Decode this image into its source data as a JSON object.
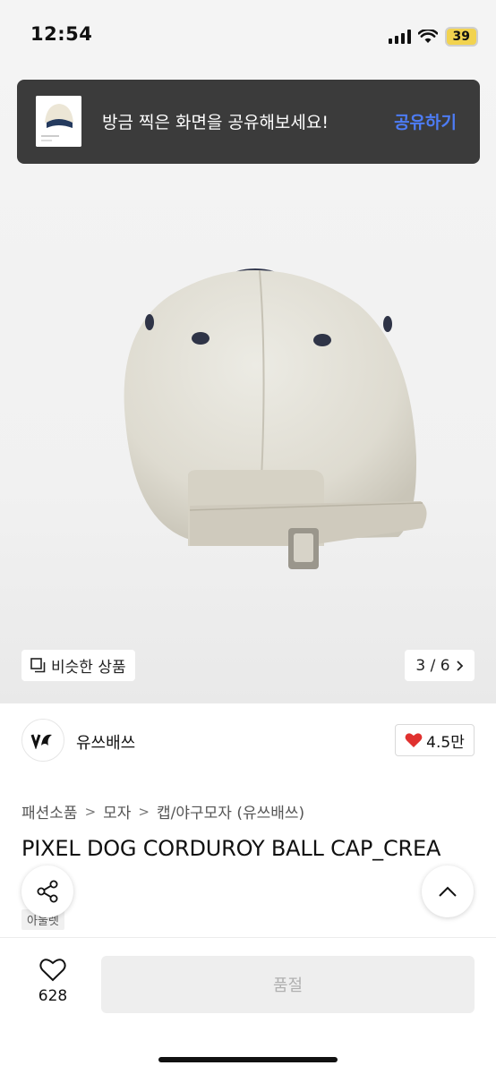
{
  "status_bar": {
    "time": "12:54",
    "battery": "39"
  },
  "share_banner": {
    "text": "방금 찍은 화면을 공유해보세요!",
    "action": "공유하기"
  },
  "image_nav": {
    "similar_label": "비슷한 상품",
    "pager": "3 / 6"
  },
  "seller": {
    "name": "유쓰배쓰",
    "likes": "4.5만"
  },
  "breadcrumb": [
    "패션소품",
    "모자",
    "캡/야구모자 (유쓰배쓰)"
  ],
  "product": {
    "title": "PIXEL DOG CORDUROY BALL CAP_CREA",
    "tag": "아울렛"
  },
  "bottom_bar": {
    "wish_count": "628",
    "buy_label": "품절"
  },
  "colors": {
    "accent": "#4d7cf5",
    "like_heart": "#e0312f",
    "banner_bg": "#3b3b3b"
  },
  "icons": [
    "signal-icon",
    "wifi-icon",
    "heart-icon",
    "copy-icon",
    "chevron-right-icon",
    "share-icon",
    "chevron-up-icon"
  ]
}
